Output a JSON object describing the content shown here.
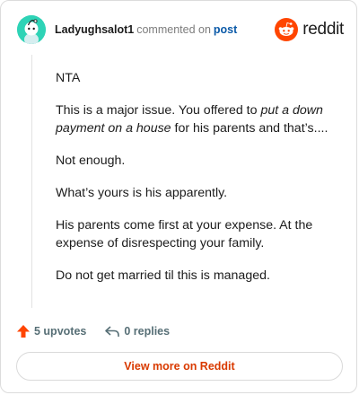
{
  "header": {
    "username": "Ladyughsalot1",
    "commented_text": "commented on",
    "post_link": "post",
    "brand": "reddit",
    "brand_color": "#ff4500",
    "avatar_color": "#2ed3b6",
    "avatar_icon": "snoo-avatar-icon"
  },
  "comment": {
    "paragraphs": [
      [
        {
          "text": "NTA",
          "italic": false
        }
      ],
      [
        {
          "text": "This is a major issue. You offered to ",
          "italic": false
        },
        {
          "text": "put a down payment on a house",
          "italic": true
        },
        {
          "text": " for his parents and that’s....",
          "italic": false
        }
      ],
      [
        {
          "text": "Not enough.",
          "italic": false
        }
      ],
      [
        {
          "text": "What’s yours is his apparently.",
          "italic": false
        }
      ],
      [
        {
          "text": "His parents come first at your expense. At the expense of disrespecting your family.",
          "italic": false
        }
      ],
      [
        {
          "text": "Do not get married til this is managed.",
          "italic": false
        }
      ]
    ]
  },
  "actions": {
    "upvotes": "5 upvotes",
    "upvote_icon": "upvote-arrow-icon",
    "upvote_color": "#ff4500",
    "replies": "0 replies",
    "reply_icon": "reply-arrow-icon"
  },
  "footer": {
    "view_more": "View more on Reddit",
    "view_more_color": "#d93a00"
  }
}
